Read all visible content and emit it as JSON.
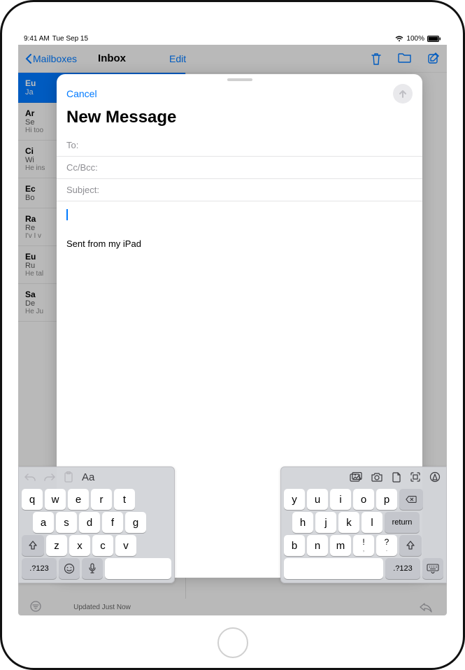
{
  "status": {
    "time": "9:41 AM",
    "date": "Tue Sep 15",
    "battery": "100%"
  },
  "mail": {
    "back": "Mailboxes",
    "title": "Inbox",
    "edit": "Edit",
    "footer": "Updated Just Now",
    "items": [
      {
        "sender": "Eu",
        "subj": "Ja",
        "preview": ""
      },
      {
        "sender": "Ar",
        "subj": "Se",
        "preview": "Hi\ntoo"
      },
      {
        "sender": "Ci",
        "subj": "Wi",
        "preview": "He\nins"
      },
      {
        "sender": "Ec",
        "subj": "Bo",
        "preview": ""
      },
      {
        "sender": "Ra",
        "subj": "Re",
        "preview": "I'v\nI v"
      },
      {
        "sender": "Eu",
        "subj": "Ru",
        "preview": "He\ntal"
      },
      {
        "sender": "Sa",
        "subj": "De",
        "preview": "He\nJu"
      }
    ]
  },
  "compose": {
    "cancel": "Cancel",
    "title": "New Message",
    "to_label": "To:",
    "cc_label": "Cc/Bcc:",
    "subject_label": "Subject:",
    "signature": "Sent from my iPad"
  },
  "keyboard": {
    "left": {
      "toolbar": {
        "format": "Aa"
      },
      "rows": [
        [
          "q",
          "w",
          "e",
          "r",
          "t"
        ],
        [
          "a",
          "s",
          "d",
          "f",
          "g"
        ],
        [
          "z",
          "x",
          "c",
          "v"
        ]
      ],
      "numKey": ".?123"
    },
    "right": {
      "rows": [
        [
          "y",
          "u",
          "i",
          "o",
          "p"
        ],
        [
          "h",
          "j",
          "k",
          "l"
        ],
        [
          "b",
          "n",
          "m",
          "!",
          ",?"
        ]
      ],
      "return": "return",
      "numKey": ".?123",
      "punct1": "!",
      "punct2": "?",
      "comma": ","
    }
  }
}
